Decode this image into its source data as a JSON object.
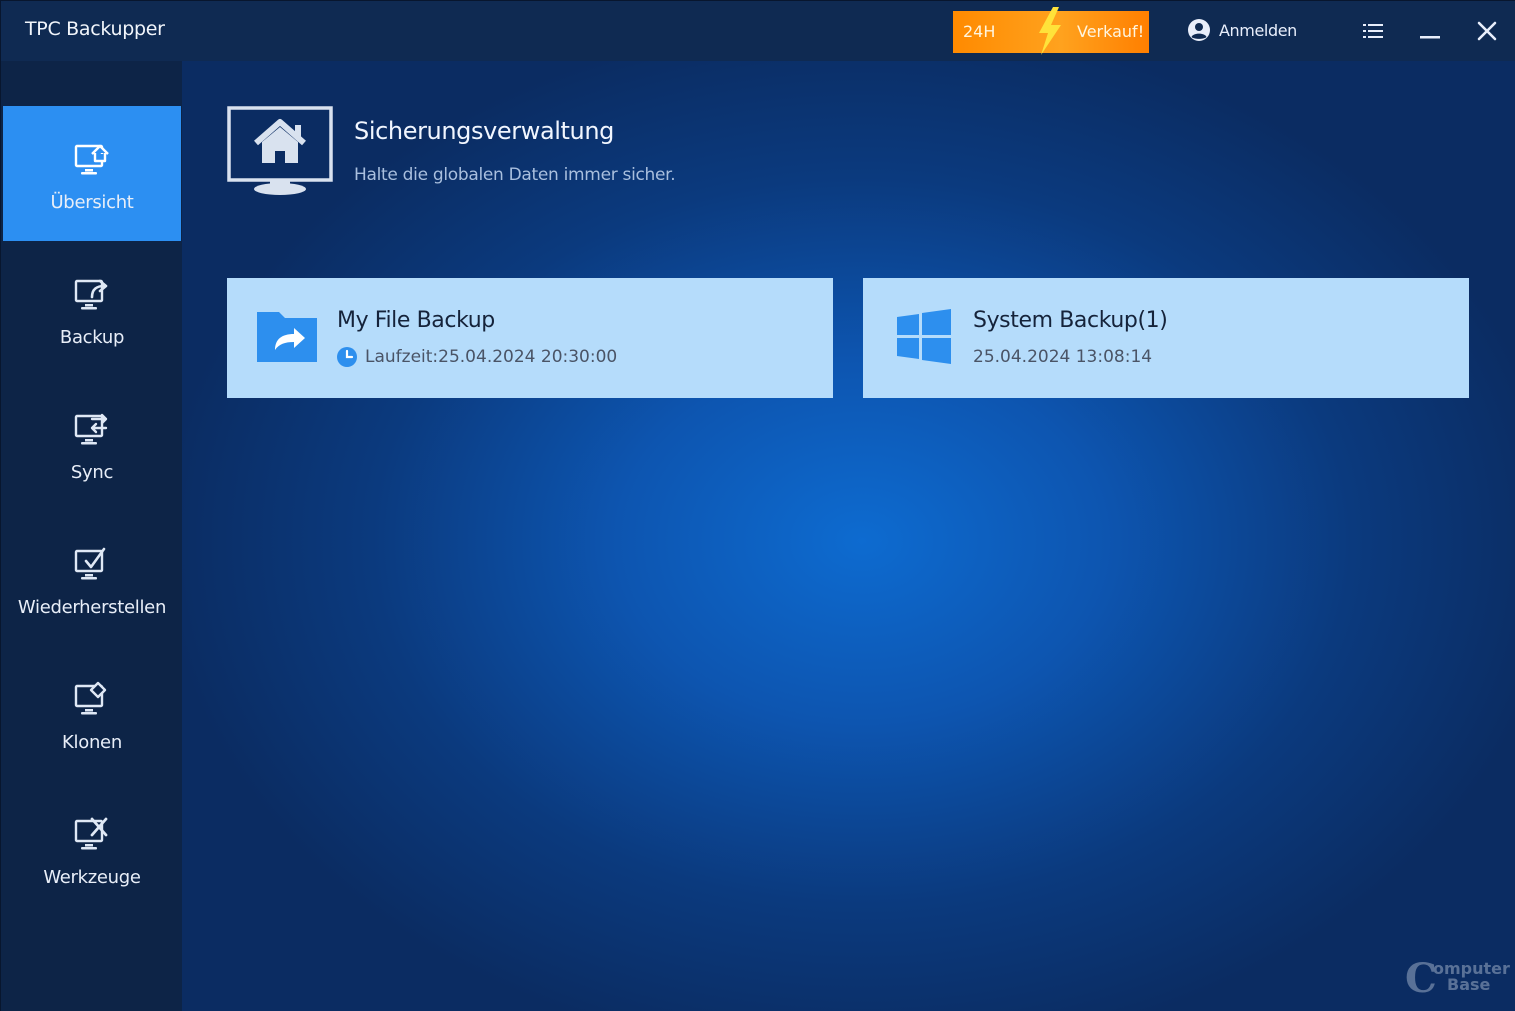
{
  "window": {
    "title": "TPC Backupper"
  },
  "promo": {
    "left_text": "24H",
    "right_text": "Verkauf!"
  },
  "login": {
    "label": "Anmelden"
  },
  "sidebar": {
    "items": [
      {
        "label": "Übersicht",
        "icon": "overview-monitor-icon",
        "active": true
      },
      {
        "label": "Backup",
        "icon": "backup-monitor-icon",
        "active": false
      },
      {
        "label": "Sync",
        "icon": "sync-monitor-icon",
        "active": false
      },
      {
        "label": "Wiederherstellen",
        "icon": "restore-monitor-icon",
        "active": false
      },
      {
        "label": "Klonen",
        "icon": "clone-monitor-icon",
        "active": false
      },
      {
        "label": "Werkzeuge",
        "icon": "tools-monitor-icon",
        "active": false
      }
    ]
  },
  "main": {
    "title": "Sicherungsverwaltung",
    "subtitle": "Halte die globalen Daten immer sicher.",
    "cards": [
      {
        "title": "My File Backup",
        "meta": "Laufzeit:25.04.2024 20:30:00",
        "icon": "folder-share-icon"
      },
      {
        "title": "System Backup(1)",
        "meta": "25.04.2024 13:08:14",
        "icon": "windows-logo-icon"
      }
    ]
  },
  "watermark": {
    "c": "C",
    "line1": "omputer",
    "line2": "Base"
  },
  "colors": {
    "accent": "#2c8ff2",
    "promo": "#ff8a00",
    "card": "#b5dcfb"
  }
}
